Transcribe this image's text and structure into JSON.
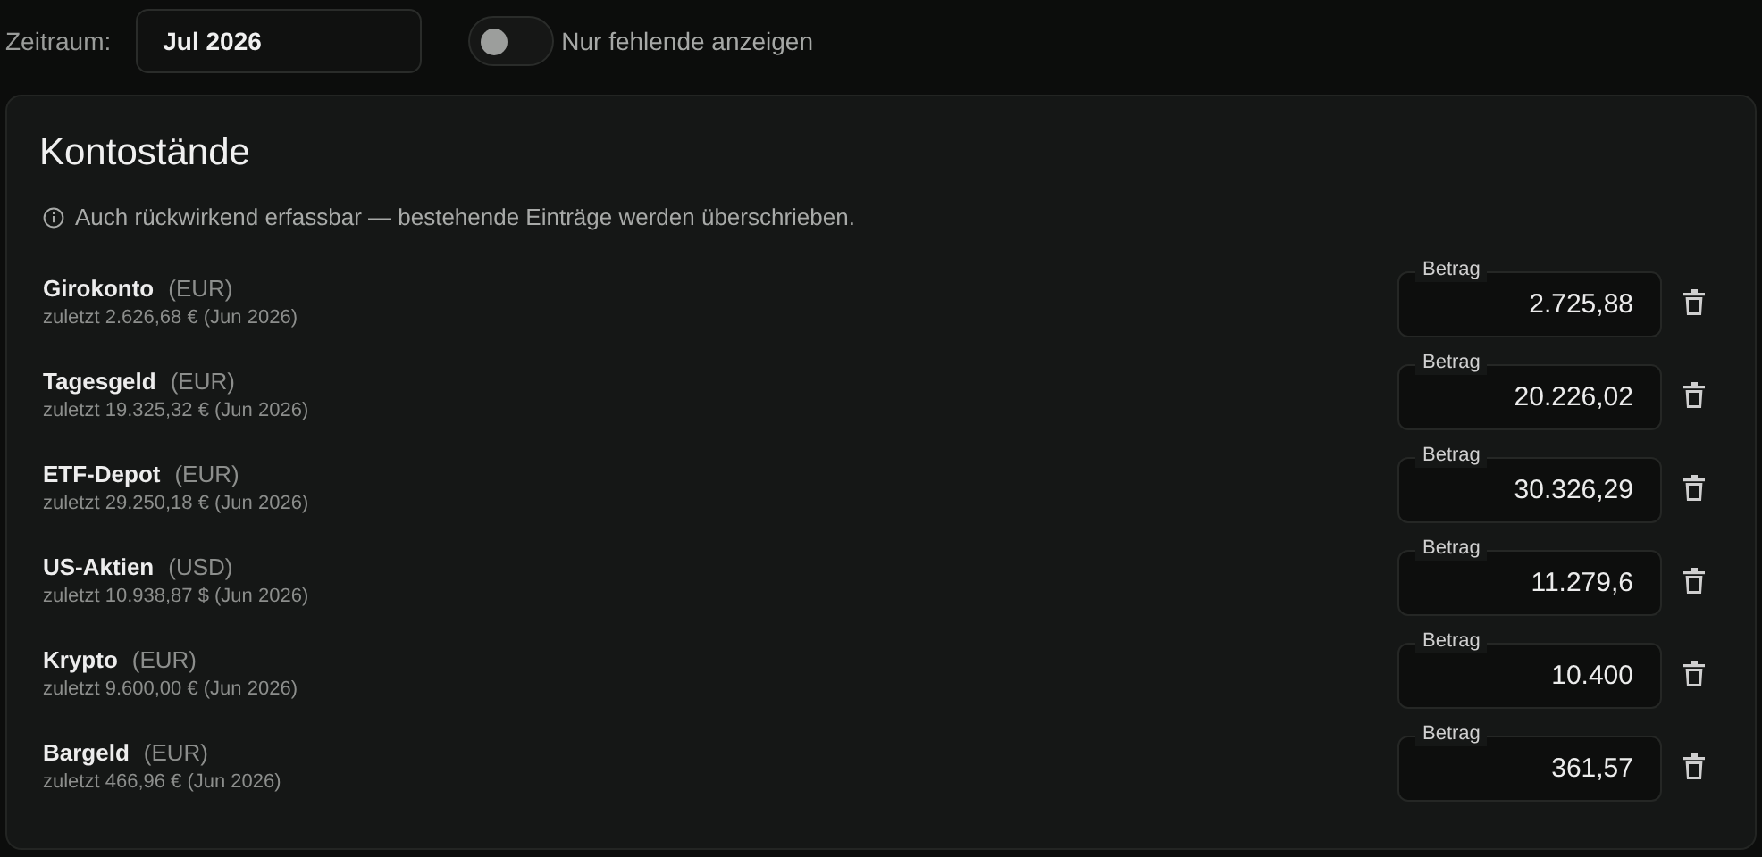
{
  "filter": {
    "label": "Zeitraum:",
    "value": "Jul 2026"
  },
  "toggle": {
    "label": "Nur fehlende anzeigen",
    "on": false
  },
  "card": {
    "title": "Kontostände",
    "hint": "Auch rückwirkend erfassbar — bestehende Einträge werden überschrieben.",
    "accounts": [
      {
        "name": "Girokonto",
        "currency": "(EUR)",
        "last": "zuletzt 2.626,68 € (Jun 2026)",
        "field_label": "Betrag",
        "value": "2.725,88"
      },
      {
        "name": "Tagesgeld",
        "currency": "(EUR)",
        "last": "zuletzt 19.325,32 € (Jun 2026)",
        "field_label": "Betrag",
        "value": "20.226,02"
      },
      {
        "name": "ETF-Depot",
        "currency": "(EUR)",
        "last": "zuletzt 29.250,18 € (Jun 2026)",
        "field_label": "Betrag",
        "value": "30.326,29"
      },
      {
        "name": "US-Aktien",
        "currency": "(USD)",
        "last": "zuletzt 10.938,87 $ (Jun 2026)",
        "field_label": "Betrag",
        "value": "11.279,6"
      },
      {
        "name": "Krypto",
        "currency": "(EUR)",
        "last": "zuletzt 9.600,00 € (Jun 2026)",
        "field_label": "Betrag",
        "value": "10.400"
      },
      {
        "name": "Bargeld",
        "currency": "(EUR)",
        "last": "zuletzt 466,96 € (Jun 2026)",
        "field_label": "Betrag",
        "value": "361,57"
      }
    ]
  }
}
